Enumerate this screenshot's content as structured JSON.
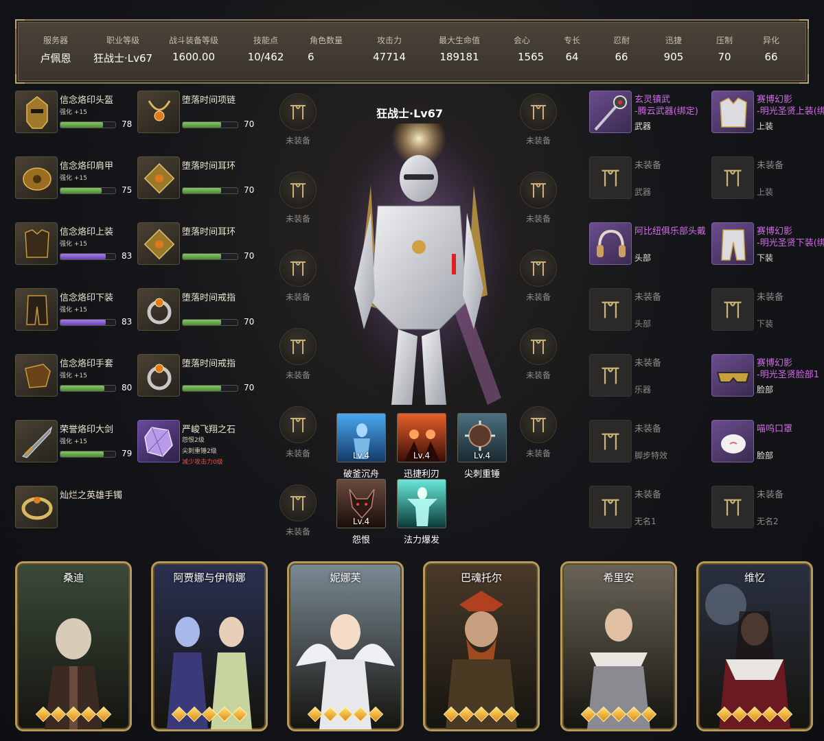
{
  "stats": {
    "headers": [
      "服务器",
      "职业等级",
      "战斗装备等级",
      "技能点",
      "角色数量",
      "攻击力",
      "最大生命值",
      "会心",
      "专长",
      "忍耐",
      "迅捷",
      "压制",
      "异化"
    ],
    "values": [
      "卢佩恩",
      "狂战士·Lv67",
      "1600.00",
      "10/462",
      "6",
      "47714",
      "189181",
      "1565",
      "64",
      "66",
      "905",
      "70",
      "66"
    ]
  },
  "left_gear_col1": [
    {
      "name": "信念烙印头盔",
      "enh": "强化 +15",
      "quality": 78,
      "bar": "green"
    },
    {
      "name": "信念烙印肩甲",
      "enh": "强化 +15",
      "quality": 75,
      "bar": "green"
    },
    {
      "name": "信念烙印上装",
      "enh": "强化 +15",
      "quality": 83,
      "bar": "purple"
    },
    {
      "name": "信念烙印下装",
      "enh": "强化 +15",
      "quality": 83,
      "bar": "purple"
    },
    {
      "name": "信念烙印手套",
      "enh": "强化 +15",
      "quality": 80,
      "bar": "green"
    },
    {
      "name": "荣誉烙印大剑",
      "enh": "强化 +15",
      "quality": 79,
      "bar": "green"
    },
    {
      "name": "灿烂之英雄手镯"
    }
  ],
  "left_gear_col2": [
    {
      "name": "堕落时间项链",
      "quality": 70
    },
    {
      "name": "堕落时间耳环",
      "quality": 70
    },
    {
      "name": "堕落时间耳环",
      "quality": 70
    },
    {
      "name": "堕落时间戒指",
      "quality": 70
    },
    {
      "name": "堕落时间戒指",
      "quality": 70
    },
    {
      "name": "严峻飞翔之石",
      "lines": [
        "怨恨2级",
        "尖刺重锤2级",
        "减少攻击力0级"
      ]
    }
  ],
  "empty_label": "未装备",
  "character": {
    "title": "狂战士·Lv67"
  },
  "skills": [
    {
      "name": "破釜沉舟",
      "level": "Lv.4",
      "color": "#3a8ad0"
    },
    {
      "name": "迅捷利刃",
      "level": "Lv.4",
      "color": "#c0461e"
    },
    {
      "name": "尖刺重锤",
      "level": "Lv.4",
      "color": "#3a5560"
    },
    {
      "name": "怨恨",
      "level": "Lv.4",
      "color": "#5a3a34"
    },
    {
      "name": "法力爆发",
      "level": "",
      "color": "#2a9a94"
    }
  ],
  "right_col1": [
    {
      "t1": "玄灵镇武",
      "t2": "-腾云武器(绑定)",
      "cat": "武器",
      "filled": true
    },
    {
      "t1": "未装备",
      "cat": "武器",
      "filled": false
    },
    {
      "t1": "阿比纽俱乐部头戴",
      "cat": "头部",
      "filled": true
    },
    {
      "t1": "未装备",
      "cat": "头部",
      "filled": false
    },
    {
      "t1": "未装备",
      "cat": "乐器",
      "filled": false
    },
    {
      "t1": "未装备",
      "cat": "脚步特效",
      "filled": false
    },
    {
      "t1": "未装备",
      "cat": "无名1",
      "filled": false
    }
  ],
  "right_col2": [
    {
      "t1": "赛博幻影",
      "t2": "-明光圣贤上装(绑",
      "cat": "上装",
      "filled": true
    },
    {
      "t1": "未装备",
      "cat": "上装",
      "filled": false
    },
    {
      "t1": "赛博幻影",
      "t2": "-明光圣贤下装(绑",
      "cat": "下装",
      "filled": true
    },
    {
      "t1": "未装备",
      "cat": "下装",
      "filled": false
    },
    {
      "t1": "赛博幻影",
      "t2": "-明光圣贤脸部1",
      "cat": "脸部",
      "filled": true
    },
    {
      "t1": "喵呜口罩",
      "cat": "脸部",
      "filled": true
    },
    {
      "t1": "未装备",
      "cat": "无名2",
      "filled": false
    }
  ],
  "cards": [
    {
      "name": "桑迪",
      "stars": 5,
      "bg": "#3a4a3a"
    },
    {
      "name": "阿贾娜与伊南娜",
      "stars": 5,
      "bg": "#2a3050"
    },
    {
      "name": "妮娜芙",
      "stars": 5,
      "bg": "#7a8a94"
    },
    {
      "name": "巴魂托尔",
      "stars": 5,
      "bg": "#4a3a2a"
    },
    {
      "name": "希里安",
      "stars": 5,
      "bg": "#6a6458"
    },
    {
      "name": "维忆",
      "stars": 5,
      "bg": "#2a3040"
    }
  ],
  "colors": {
    "accent_gold": "#b79a5a",
    "rarity_purple": "#d36ae8",
    "bar_green": "#6aa84f",
    "bar_purple": "#8a5ad0"
  }
}
